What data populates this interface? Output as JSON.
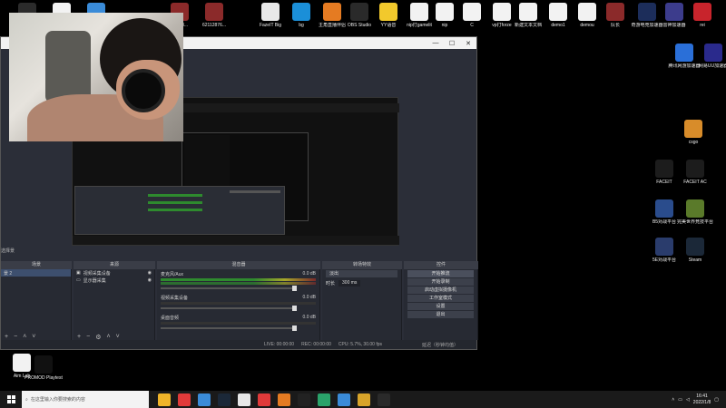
{
  "top_icons": [
    {
      "label": "",
      "color": "#2b2b2b"
    },
    {
      "label": "",
      "color": "#f2f2f2"
    },
    {
      "label": "",
      "color": "#3a8bd8"
    },
    {
      "label": "82948...",
      "color": "#8b2a2a"
    },
    {
      "label": "62112876...",
      "color": "#8b2a2a"
    },
    {
      "label": "FazeIT Big",
      "color": "#e8e8e8"
    },
    {
      "label": "bg",
      "color": "#1b8fd8"
    },
    {
      "label": "主角直播伴侣",
      "color": "#e57b22"
    },
    {
      "label": "OBS Studio",
      "color": "#2a2a2a"
    },
    {
      "label": "YY语音",
      "color": "#f2c92c"
    },
    {
      "label": "nip打gamelit",
      "color": "#f2f2f2"
    },
    {
      "label": "nip",
      "color": "#f2f2f2"
    },
    {
      "label": "C",
      "color": "#f2f2f2"
    },
    {
      "label": "vp打forze",
      "color": "#f2f2f2"
    },
    {
      "label": "新建文本文档",
      "color": "#f2f2f2"
    },
    {
      "label": "demo1",
      "color": "#f2f2f2"
    },
    {
      "label": "demou",
      "color": "#f2f2f2"
    },
    {
      "label": "队长",
      "color": "#8b2a2a"
    },
    {
      "label": "奇游电竞加速器",
      "color": "#1c2d5a"
    },
    {
      "label": "雷神加速器",
      "color": "#3c3c8c"
    },
    {
      "label": "rei",
      "color": "#c8242c"
    }
  ],
  "right_icons": [
    {
      "label": "腾讯网游加速器",
      "color": "#2a6fd8"
    },
    {
      "label": "网易UU加速器",
      "color": "#2a2a8c"
    },
    {
      "label": "csgo",
      "color": "#d88c2a"
    },
    {
      "label": "FACEIT",
      "color": "#1c1c1c"
    },
    {
      "label": "FACEIT AC",
      "color": "#1c1c1c"
    },
    {
      "label": "B5对战平台",
      "color": "#2a4c8c"
    },
    {
      "label": "完美世界竞技平台",
      "color": "#5a7a2a"
    },
    {
      "label": "5E对战平台",
      "color": "#2a3c6c"
    },
    {
      "label": "Steam",
      "color": "#1b2838"
    }
  ],
  "bottom_icons": [
    {
      "label": "Aim Lab",
      "color": "#f2f2f2"
    },
    {
      "label": "PROMOD Playtest",
      "color": "#111111"
    }
  ],
  "obs": {
    "title": "",
    "scene_header": "场景",
    "sources_header": "来源",
    "mixer_header": "混音器",
    "transitions_header": "转场特效",
    "controls_header": "控件",
    "scene_label": "选择景",
    "scenes": [
      "景 2"
    ],
    "sources": [
      "视频采集设备",
      "显示器采集"
    ],
    "mixer_tracks": [
      {
        "name": "桌面音频",
        "db": "0.0 dB"
      },
      {
        "name": "视频采集设备",
        "db": "0.0 dB"
      },
      {
        "name": "麦克风/Aux",
        "db": "0.0 dB"
      }
    ],
    "transition_value": "淡出",
    "duration_label": "时长",
    "duration_value": "300 ms",
    "controls": [
      "开始推流",
      "开始录制",
      "启动虚拟摄像机",
      "工作室模式",
      "设置",
      "退出"
    ],
    "status": {
      "live": "LIVE: 00:00:00",
      "rec": "REC: 00:00:00",
      "cpu": "CPU: 5.7%, 30.00 fps"
    },
    "status_right": "延迟（秒钟均值）"
  },
  "taskbar": {
    "search_placeholder": "在这里输入你要搜索的内容",
    "time": "16:41",
    "date": "2022/1/8",
    "apps": [
      "#f0b429",
      "#e03a3a",
      "#3a8bd8",
      "#1b2838",
      "#e8e8e8",
      "#e03a3a",
      "#e57b22",
      "#222222",
      "#2aa36a",
      "#3a8bd8",
      "#d8a42a",
      "#2a2a2a"
    ]
  },
  "mini_label": "2022/1/8"
}
